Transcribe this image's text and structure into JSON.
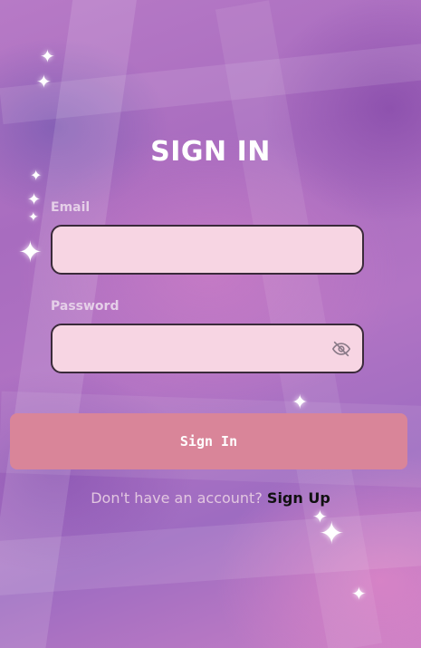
{
  "form": {
    "title": "SIGN IN",
    "email_label": "Email",
    "email_value": "",
    "password_label": "Password",
    "password_value": "",
    "password_toggle_icon": "eye-slash-icon",
    "submit_label": "Sign In",
    "signup_prompt": "Don't have an account?",
    "signup_link": "Sign Up"
  },
  "colors": {
    "input_background": "#f7d5e3",
    "input_border": "#3a2a3a",
    "button_background": "#d98599",
    "label_color": "#e5cfe8",
    "title_color": "#ffffff"
  }
}
